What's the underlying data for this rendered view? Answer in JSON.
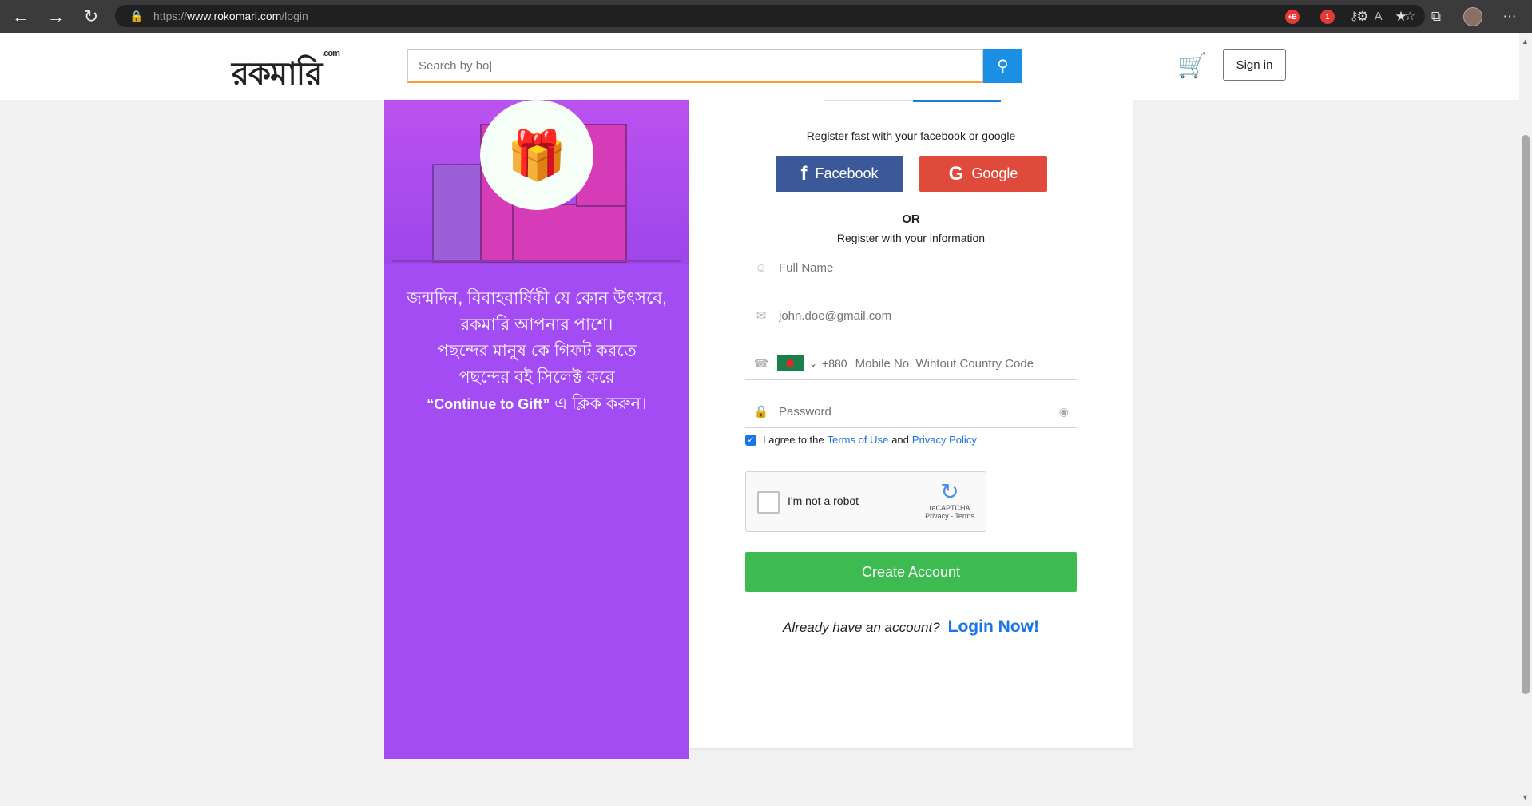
{
  "browser": {
    "url_prefix": "https://",
    "url_host": "www.rokomari.com",
    "url_path": "/login",
    "extension_badge": "1"
  },
  "header": {
    "logo_text": "রকমারি",
    "logo_suffix": ".com",
    "search_placeholder": "Search by bo|",
    "signin_label": "Sign in"
  },
  "promo": {
    "line1": "জন্মদিন, বিবাহবার্ষিকী যে কোন উৎসবে,",
    "line2": "রকমারি আপনার পাশে।",
    "line3": "পছন্দের মানুষ কে গিফট করতে",
    "line4": "পছন্দের বই সিলেক্ট করে",
    "line5_en": "“Continue to Gift”",
    "line5_bn": " এ ক্লিক করুন।"
  },
  "form": {
    "social_prompt": "Register fast with your facebook or google",
    "facebook_label": "Facebook",
    "google_label": "Google",
    "or_label": "OR",
    "info_prompt": "Register with your information",
    "fullname_placeholder": "Full Name",
    "email_placeholder": "john.doe@gmail.com",
    "country_code": "+880",
    "phone_placeholder": "Mobile No. Wihtout Country Code",
    "password_placeholder": "Password",
    "agree_prefix": "I agree to the",
    "terms_label": "Terms of Use",
    "agree_and": "and",
    "privacy_label": "Privacy Policy",
    "captcha_label": "I'm not a robot",
    "captcha_brand": "reCAPTCHA",
    "captcha_links": "Privacy - Terms",
    "create_label": "Create Account",
    "already_label": "Already have an account?",
    "login_label": "Login Now!"
  },
  "colors": {
    "promo_bg": "#a34cf4",
    "facebook": "#3b5998",
    "google": "#e04a3a",
    "create": "#3dbb51",
    "link": "#1a73e8"
  }
}
